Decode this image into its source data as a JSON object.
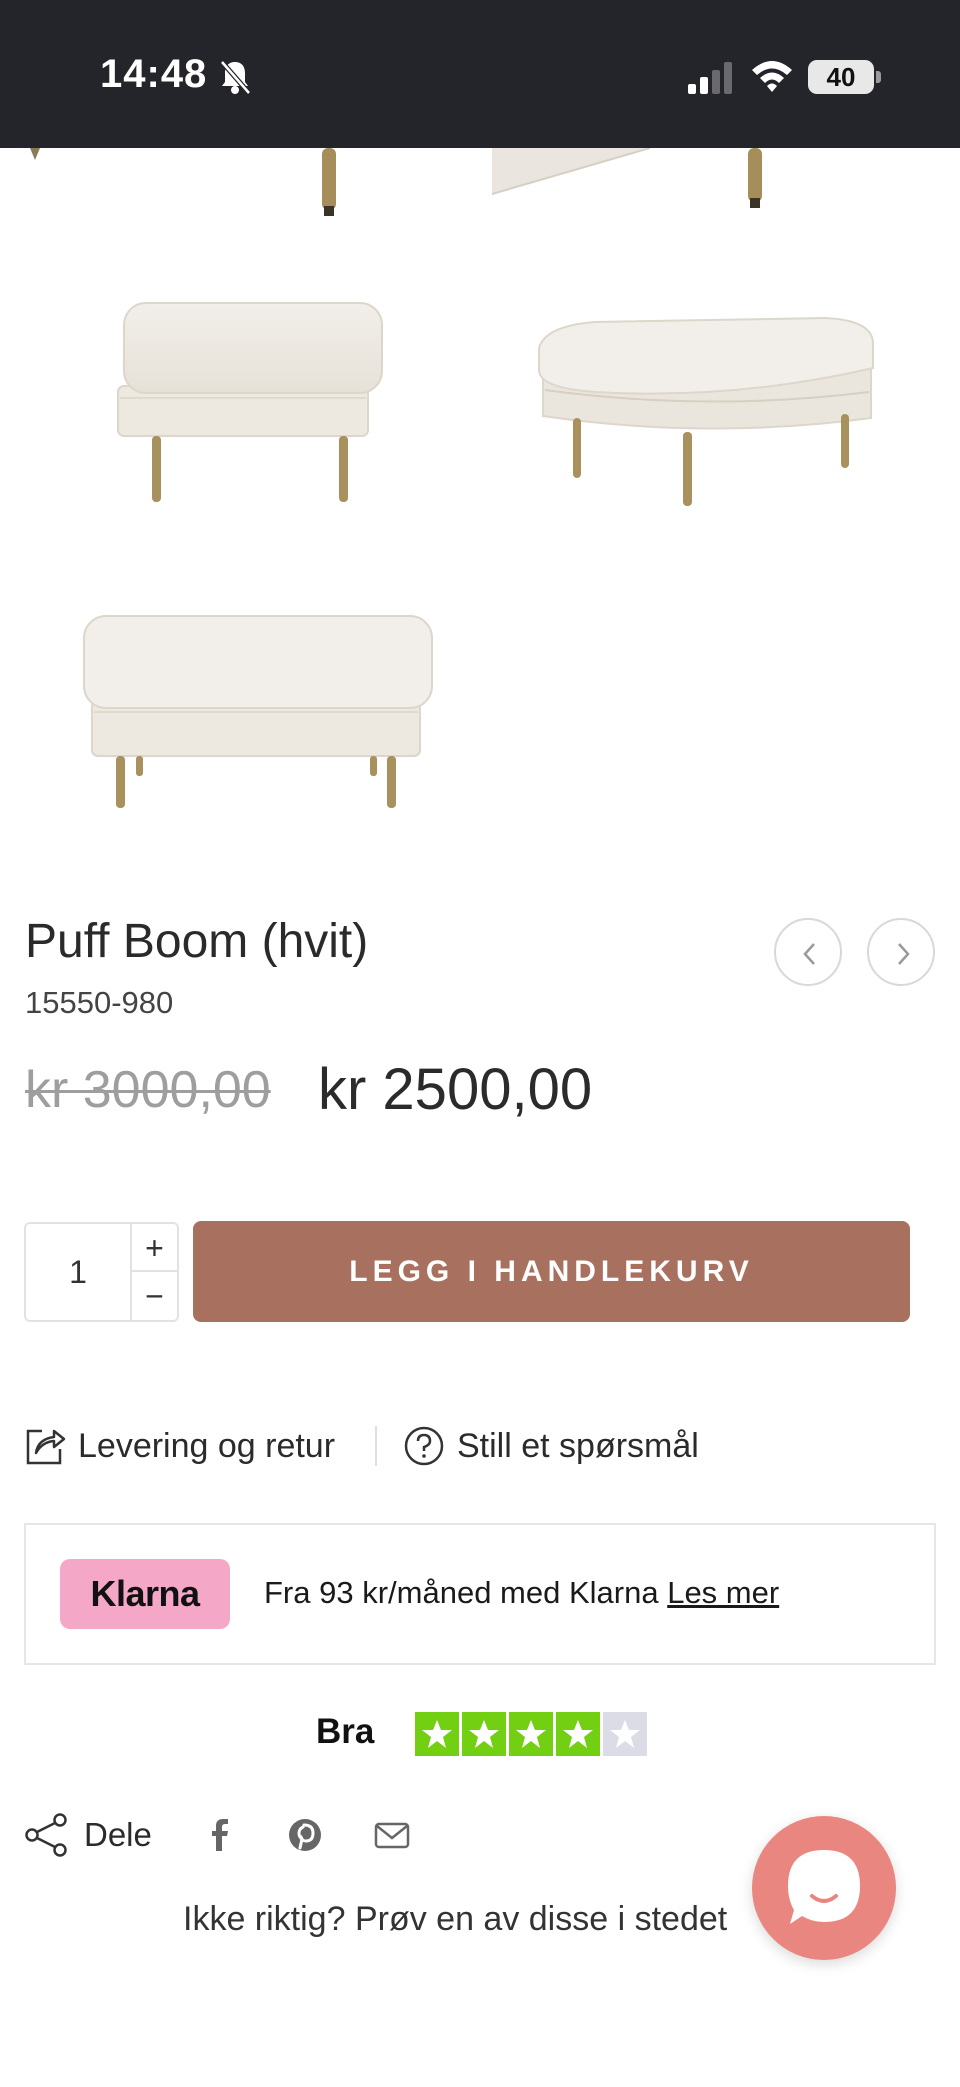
{
  "status_bar": {
    "time": "14:48",
    "battery": "40"
  },
  "product": {
    "title": "Puff Boom (hvit)",
    "sku": "15550-980",
    "old_price": "kr 3000,00",
    "new_price": "kr 2500,00"
  },
  "cart": {
    "quantity": "1",
    "plus": "+",
    "minus": "−",
    "add_label": "LEGG I HANDLEKURV"
  },
  "links": {
    "delivery": "Levering og retur",
    "question": "Still et spørsmål"
  },
  "klarna": {
    "badge": "Klarna",
    "text": "Fra 93 kr/måned med Klarna",
    "link": "Les mer"
  },
  "trustpilot": {
    "label": "Bra",
    "rating_stars": 4,
    "max_stars": 5
  },
  "share": {
    "label": "Dele"
  },
  "alternatives": {
    "text": "Ikke riktig? Prøv en av disse i stedet"
  },
  "colors": {
    "cart_button": "#a8705e",
    "klarna_pink": "#f4a7c6",
    "star_green": "#73cf11",
    "chat": "#e9867f"
  },
  "icons": [
    "bell-slash-icon",
    "signal-icon",
    "wifi-icon",
    "battery-icon",
    "chevron-left-icon",
    "chevron-right-icon",
    "share-arrow-icon",
    "question-circle-icon",
    "star-icon",
    "share-nodes-icon",
    "facebook-icon",
    "pinterest-icon",
    "mail-icon",
    "chat-icon"
  ]
}
